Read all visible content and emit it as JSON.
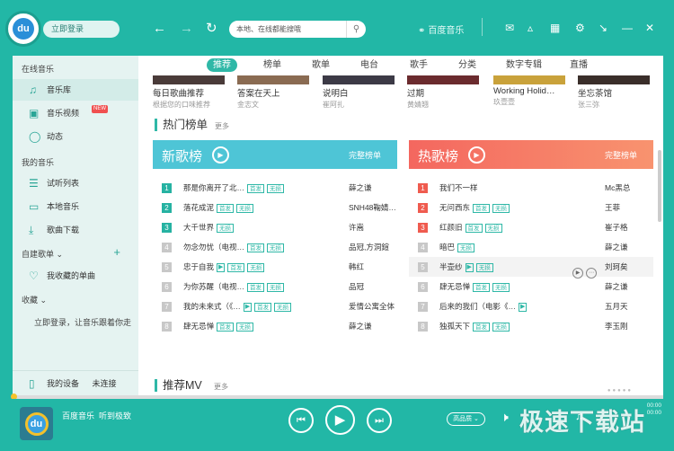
{
  "topbar": {
    "login": "立即登录",
    "search_placeholder": "本地、在线都能搜哦",
    "brand": "百度音乐"
  },
  "sidebar": {
    "online_head": "在线音乐",
    "items": [
      {
        "label": "音乐库",
        "icon": "music-note-icon"
      },
      {
        "label": "音乐视频",
        "icon": "tv-icon",
        "badge": "NEW"
      },
      {
        "label": "动态",
        "icon": "activity-icon"
      }
    ],
    "my_head": "我的音乐",
    "my_items": [
      {
        "label": "试听列表",
        "icon": "list-icon"
      },
      {
        "label": "本地音乐",
        "icon": "monitor-icon"
      },
      {
        "label": "歌曲下载",
        "icon": "download-icon"
      }
    ],
    "custom_head": "自建歌单",
    "fav": "我收藏的单曲",
    "collect_head": "收藏",
    "collect_hint": "立即登录，让音乐跟着你走",
    "device": "我的设备",
    "device_status": "未连接"
  },
  "tabs": [
    "推荐",
    "榜单",
    "歌单",
    "电台",
    "歌手",
    "分类",
    "数字专辑",
    "直播"
  ],
  "recs": [
    {
      "title": "每日歌曲推荐",
      "artist": "根据您的口味推荐"
    },
    {
      "title": "答案在天上",
      "artist": "金志文"
    },
    {
      "title": "说明白",
      "artist": "崔阿扎"
    },
    {
      "title": "过期",
      "artist": "黄婧翘"
    },
    {
      "title": "Working Holid…",
      "artist": "玖壹壹"
    },
    {
      "title": "坐忘茶馆",
      "artist": "张三弥"
    }
  ],
  "hot_section": {
    "title": "热门榜单",
    "more": "更多"
  },
  "new_chart": {
    "name": "新歌榜",
    "full": "完整榜单",
    "rows": [
      {
        "rank": "1",
        "song": "那是你离开了北…",
        "badges": [
          "首发",
          "无损"
        ],
        "artist": "薛之谦"
      },
      {
        "rank": "2",
        "song": "落花成泥",
        "badges": [
          "首发",
          "无损"
        ],
        "artist": "SNH48鞠婧…"
      },
      {
        "rank": "3",
        "song": "大千世界",
        "badges": [
          "无损"
        ],
        "artist": "许嵩"
      },
      {
        "rank": "4",
        "song": "勿念勿忧（电视…",
        "badges": [
          "首发",
          "无损"
        ],
        "artist": "品冠,方洞鍹"
      },
      {
        "rank": "5",
        "song": "忠于自我",
        "badges": [
          "首发",
          "无损"
        ],
        "artist": "韩红",
        "mv": true
      },
      {
        "rank": "6",
        "song": "为你苏醒（电视…",
        "badges": [
          "首发",
          "无损"
        ],
        "artist": "品冠"
      },
      {
        "rank": "7",
        "song": "我的未来式（《…",
        "badges": [
          "首发",
          "无损"
        ],
        "artist": "爱情公寓全体",
        "mv": true
      },
      {
        "rank": "8",
        "song": "肆无忌惮",
        "badges": [
          "首发",
          "无损"
        ],
        "artist": "薛之谦"
      }
    ]
  },
  "hot_chart": {
    "name": "热歌榜",
    "full": "完整榜单",
    "rows": [
      {
        "rank": "1",
        "song": "我们不一样",
        "badges": [],
        "artist": "Mc黑总"
      },
      {
        "rank": "2",
        "song": "无问西东",
        "badges": [
          "首发",
          "无损"
        ],
        "artist": "王菲"
      },
      {
        "rank": "3",
        "song": "红颜旧",
        "badges": [
          "首发",
          "无损"
        ],
        "artist": "崔子格"
      },
      {
        "rank": "4",
        "song": "暗巴",
        "badges": [
          "无损"
        ],
        "artist": "薛之谦"
      },
      {
        "rank": "5",
        "song": "半壶纱",
        "badges": [
          "无损"
        ],
        "artist": "刘珂矣",
        "mv": true
      },
      {
        "rank": "6",
        "song": "肆无忌惮",
        "badges": [
          "首发",
          "无损"
        ],
        "artist": "薛之谦"
      },
      {
        "rank": "7",
        "song": "后来的我们（电影《…",
        "badges": [],
        "artist": "五月天",
        "mv": true
      },
      {
        "rank": "8",
        "song": "独孤天下",
        "badges": [
          "首发",
          "无损"
        ],
        "artist": "李玉刚"
      }
    ]
  },
  "mv_section": {
    "title": "推荐MV",
    "more": "更多"
  },
  "player": {
    "app": "百度音乐",
    "slogan": "听到极致",
    "time_cur": "00:00",
    "time_total": "00:00",
    "quality": "高品质"
  },
  "watermark": "极速下载站",
  "colors": {
    "accent": "#22b7a6",
    "new_chart": "#4ec5d6",
    "hot_chart": "#f76d66",
    "rank_top": "#26b2a2",
    "rank_hot": "#ef5b4f",
    "rank_rest": "#c8c8c8"
  }
}
